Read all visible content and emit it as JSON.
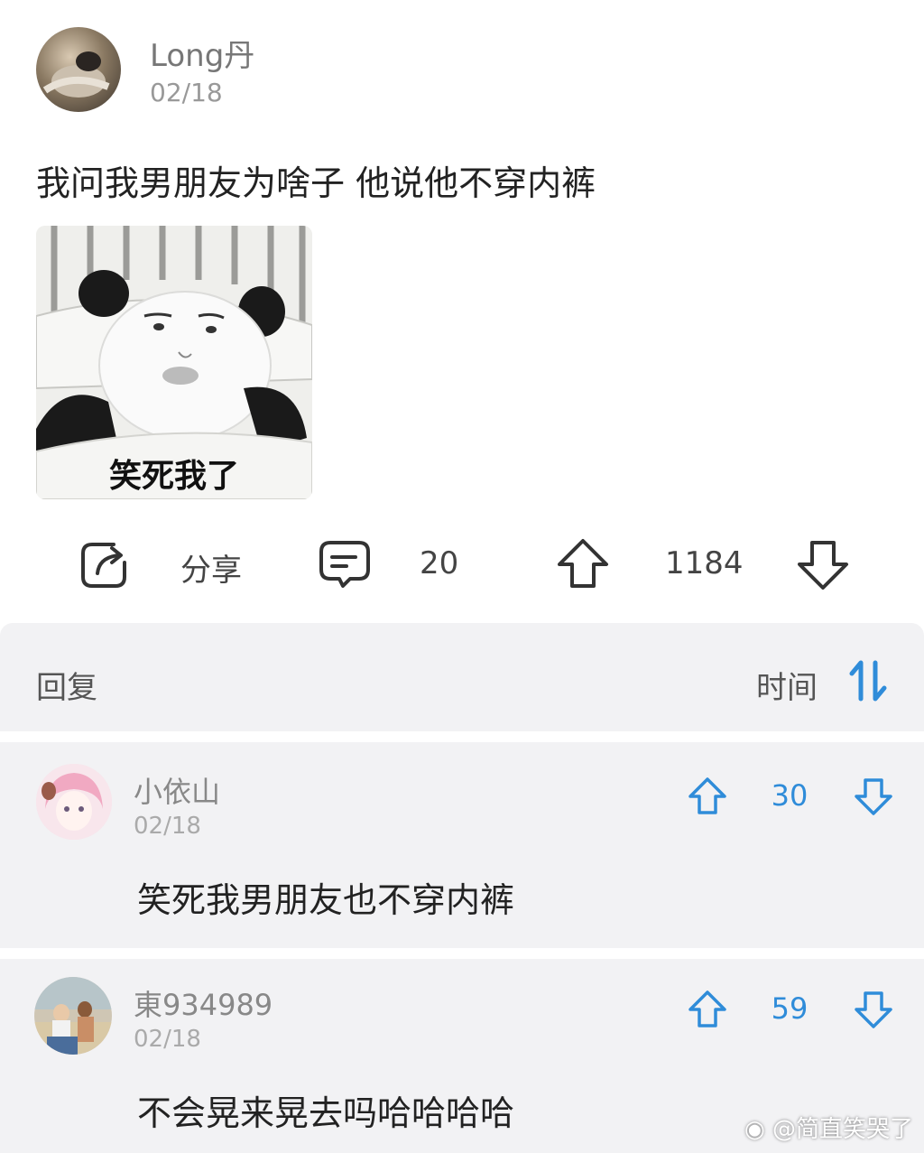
{
  "post": {
    "author": "Long丹",
    "date": "02/18",
    "text": "我问我男朋友为啥子 他说他不穿内裤",
    "meme_caption": "笑死我了"
  },
  "actions": {
    "share_icon": "share-icon",
    "share_label": "分享",
    "comment_icon": "comment-icon",
    "comment_count": "20",
    "upvote_icon": "upvote-icon",
    "vote_count": "1184",
    "downvote_icon": "downvote-icon"
  },
  "replies": {
    "title": "回复",
    "sort_label": "时间",
    "sort_icon": "sort-icon"
  },
  "comments": [
    {
      "name": "小依山",
      "date": "02/18",
      "text": "笑死我男朋友也不穿内裤",
      "votes": "30"
    },
    {
      "name": "東934989",
      "date": "02/18",
      "text": "不会晃来晃去吗哈哈哈哈",
      "votes": "59"
    }
  ],
  "watermark": "@简直笑哭了",
  "colors": {
    "accent": "#2f8cd9",
    "panel_bg": "#f2f2f4"
  }
}
